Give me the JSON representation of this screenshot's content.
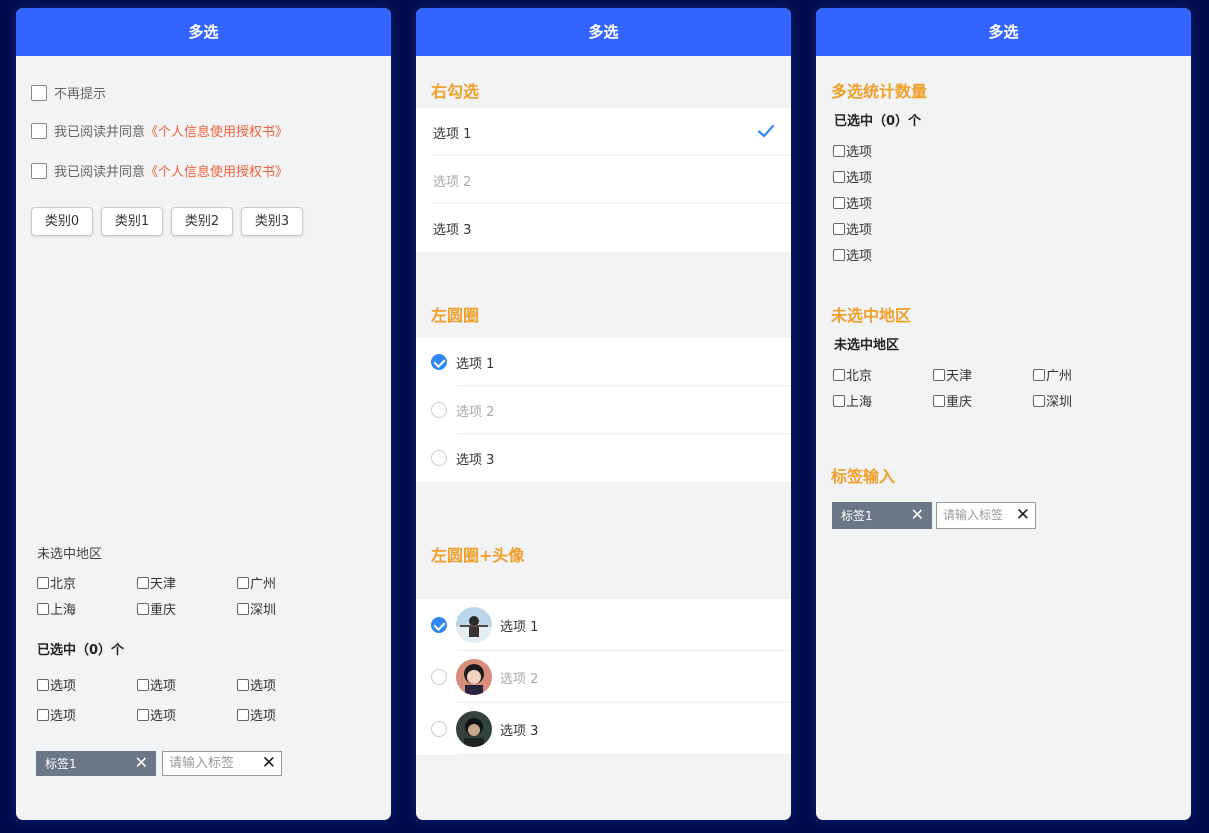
{
  "panel1": {
    "header": "多选",
    "checkbox_rows": [
      {
        "label": "不再提示",
        "link": ""
      },
      {
        "label": "我已阅读并同意",
        "link": "《个人信息使用授权书》"
      },
      {
        "label": "我已阅读并同意",
        "link": "《个人信息使用授权书》"
      }
    ],
    "category_buttons": [
      "类别0",
      "类别1",
      "类别2",
      "类别3"
    ],
    "region_title": "未选中地区",
    "regions": [
      "北京",
      "天津",
      "广州",
      "上海",
      "重庆",
      "深圳"
    ],
    "selected_count_label": "已选中（0）个",
    "options": [
      "选项",
      "选项",
      "选项",
      "选项",
      "选项",
      "选项"
    ],
    "tag": "标签1",
    "tag_placeholder": "请输入标签"
  },
  "panel2": {
    "header": "多选",
    "section_right_check": "右勾选",
    "right_items": [
      {
        "label": "选项 1",
        "checked": true,
        "disabled": false
      },
      {
        "label": "选项 2",
        "checked": false,
        "disabled": true
      },
      {
        "label": "选项 3",
        "checked": false,
        "disabled": false
      }
    ],
    "section_left_circle": "左圆圈",
    "left_items": [
      {
        "label": "选项 1",
        "checked": true,
        "disabled": false
      },
      {
        "label": "选项 2",
        "checked": false,
        "disabled": true
      },
      {
        "label": "选项 3",
        "checked": false,
        "disabled": false
      }
    ],
    "section_avatar": "左圆圈+头像",
    "avatar_items": [
      {
        "label": "选项 1",
        "checked": true,
        "disabled": false
      },
      {
        "label": "选项 2",
        "checked": false,
        "disabled": true
      },
      {
        "label": "选项 3",
        "checked": false,
        "disabled": false
      }
    ],
    "accent_color": "#2f87f5"
  },
  "panel3": {
    "header": "多选",
    "section_count": "多选统计数量",
    "selected_count_label": "已选中（0）个",
    "options": [
      "选项",
      "选项",
      "选项",
      "选项",
      "选项"
    ],
    "section_region": "未选中地区",
    "region_title": "未选中地区",
    "regions": [
      "北京",
      "天津",
      "广州",
      "上海",
      "重庆",
      "深圳"
    ],
    "section_tag": "标签输入",
    "tag": "标签1",
    "tag_placeholder": "请输入标签"
  },
  "colors": {
    "header": "#3264ff",
    "section_title": "#f0a02a",
    "link": "#f0623a",
    "background": "#020b4a"
  }
}
